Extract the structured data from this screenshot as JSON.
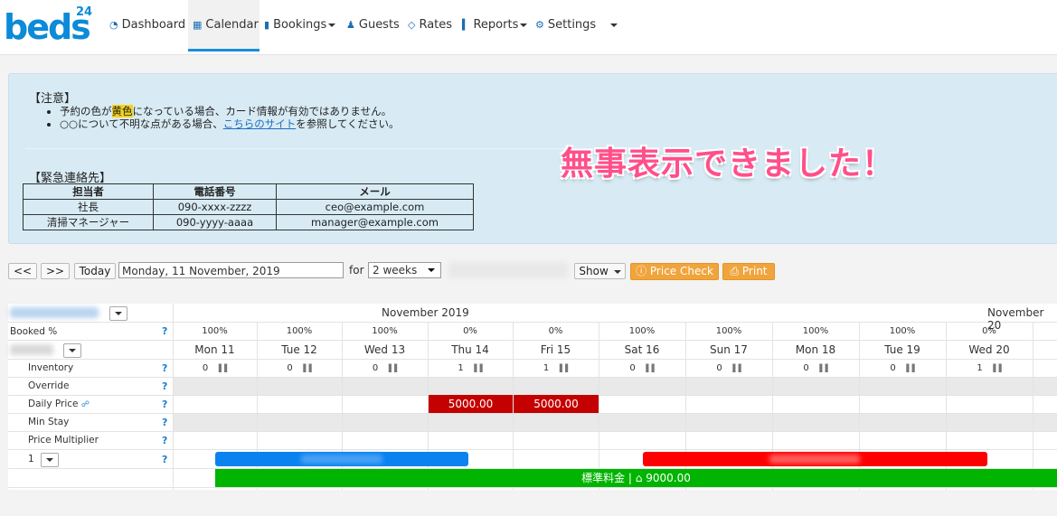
{
  "brand": {
    "logo_text": "beds",
    "logo_sup": "24"
  },
  "nav": [
    {
      "label": "Dashboard",
      "icon": "dashboard-icon",
      "caret": false
    },
    {
      "label": "Calendar",
      "icon": "calendar-icon",
      "caret": false,
      "active": true
    },
    {
      "label": "Bookings",
      "icon": "bookings-icon",
      "caret": true
    },
    {
      "label": "Guests",
      "icon": "guests-icon",
      "caret": false
    },
    {
      "label": "Rates",
      "icon": "tag-icon",
      "caret": false
    },
    {
      "label": "Reports",
      "icon": "chart-icon",
      "caret": true
    },
    {
      "label": "Settings",
      "icon": "gear-icon",
      "caret": true
    }
  ],
  "notice": {
    "heading": "【注意】",
    "line1_pre": "予約の色が",
    "line1_hl": "黄色",
    "line1_post": "になっている場合、カード情報が有効ではありません。",
    "line2_pre": "○○について不明な点がある場合、",
    "line2_link": "こちらのサイト",
    "line2_post": "を参照してください。",
    "success_message": "無事表示できました！",
    "emergency_heading": "【緊急連絡先】",
    "contact_headers": [
      "担当者",
      "電話番号",
      "メール"
    ],
    "contacts": [
      [
        "社長",
        "090-xxxx-zzzz",
        "ceo@example.com"
      ],
      [
        "清掃マネージャー",
        "090-yyyy-aaaa",
        "manager@example.com"
      ]
    ]
  },
  "controls": {
    "prev": "<<",
    "next": ">>",
    "today": "Today",
    "date": "Monday, 11 November, 2019",
    "for_label": "for",
    "period": "2 weeks",
    "show": "Show",
    "price_check": "Price Check",
    "print": "Print"
  },
  "calendar": {
    "month": "November 2019",
    "month_right": "November 20",
    "booked_label": "Booked %",
    "days": [
      {
        "label": "Mon 11",
        "pct": "100%",
        "inv": "0"
      },
      {
        "label": "Tue 12",
        "pct": "100%",
        "inv": "0"
      },
      {
        "label": "Wed 13",
        "pct": "100%",
        "inv": "0"
      },
      {
        "label": "Thu 14",
        "pct": "0%",
        "inv": "1"
      },
      {
        "label": "Fri 15",
        "pct": "0%",
        "inv": "1"
      },
      {
        "label": "Sat 16",
        "pct": "100%",
        "inv": "0"
      },
      {
        "label": "Sun 17",
        "pct": "100%",
        "inv": "0"
      },
      {
        "label": "Mon 18",
        "pct": "100%",
        "inv": "0"
      },
      {
        "label": "Tue 19",
        "pct": "100%",
        "inv": "0"
      },
      {
        "label": "Wed 20",
        "pct": "0%",
        "inv": "1"
      }
    ],
    "rows": [
      "Inventory",
      "Override",
      "Daily Price",
      "Min Stay",
      "Price Multiplier"
    ],
    "room_number": "1",
    "prices": [
      "5000.00",
      "5000.00"
    ],
    "rate_bar": "標準料金 | ",
    "rate_value": "9000.00",
    "help": "?"
  },
  "colors": {
    "accent": "#1a8dd8",
    "price_red": "#c40000",
    "booking_blue": "#0a82f0",
    "booking_red": "#ff0000",
    "rate_green": "#00b400",
    "orange": "#f0a43c",
    "success_pink": "#ff4f8b"
  }
}
